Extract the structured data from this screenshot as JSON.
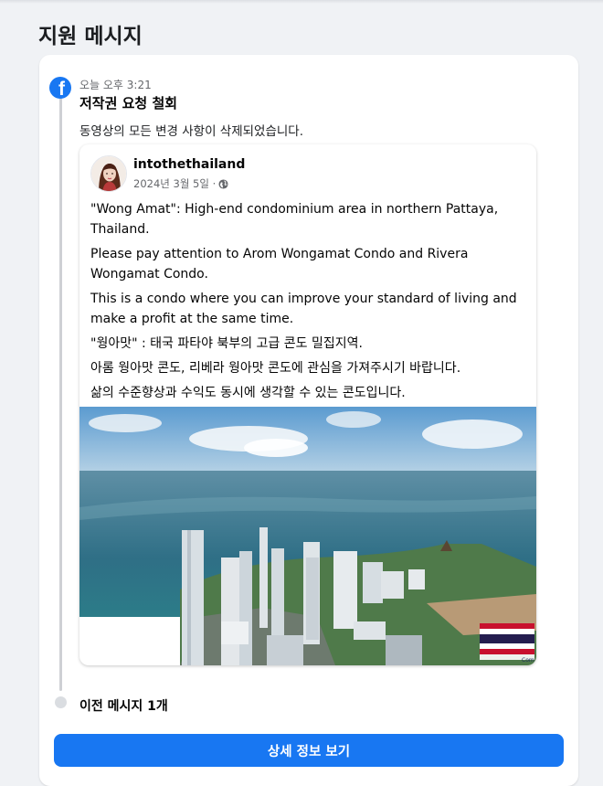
{
  "page": {
    "title": "지원 메시지"
  },
  "message": {
    "time": "오늘 오후 3:21",
    "title": "저작권 요청 철회",
    "body": "동영상의 모든 변경 사항이 삭제되었습니다.",
    "icon": "facebook-logo-icon"
  },
  "post": {
    "author": "intothethailand",
    "date": "2024년 3월 5일 ·",
    "privacy_icon": "globe-icon",
    "paragraphs": [
      "\"Wong Amat\": High-end condominium area in northern Pattaya, Thailand.",
      "Please pay attention to Arom Wongamat Condo and Rivera Wongamat Condo.",
      "This is a condo where you can improve your standard of living and make a profit at the same time.",
      "\"웡아맛\" : 태국 파타야 북부의 고급 콘도 밀집지역.",
      "아롬 웡아맛 콘도, 리베라 웡아맛 콘도에 관심을 가져주시기 바랍니다.",
      "삶의 수준향상과 수익도 동시에 생각할 수 있는 콘도입니다."
    ],
    "image_watermark": "Com"
  },
  "previous": {
    "label": "이전 메시지 1개"
  },
  "actions": {
    "detail_label": "상세 정보 보기"
  },
  "colors": {
    "accent": "#1877f2",
    "background": "#f0f2f5",
    "card": "#ffffff"
  }
}
